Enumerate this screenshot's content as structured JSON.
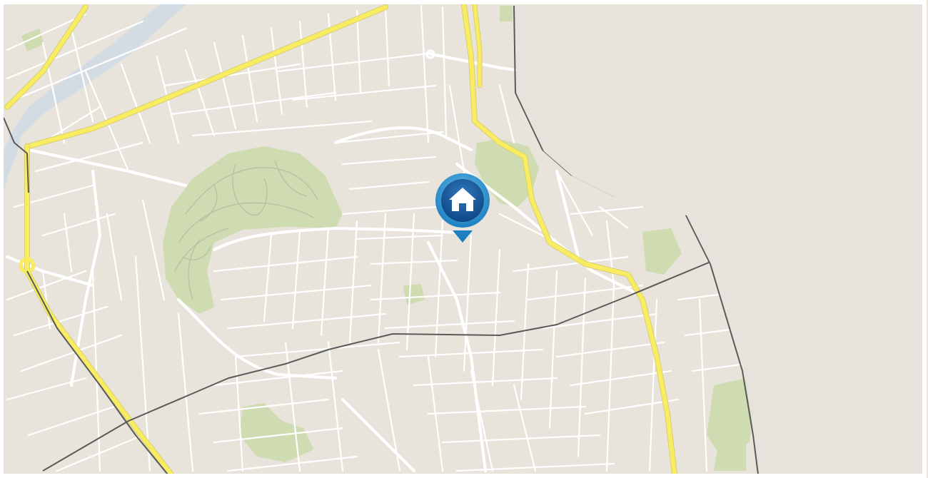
{
  "map": {
    "colors": {
      "land": "#e8e4dc",
      "land_east": "#e6e2dc",
      "park": "#cfdcb2",
      "park_path": "#b9c29f",
      "water": "#d3dbe3",
      "street": "#ffffff",
      "street_edge": "#d8d4cb",
      "highway": "#f7ec62",
      "highway_edge": "#d9cf70",
      "boundary": "#5a5a5a",
      "frame": "#ffffff"
    },
    "marker": {
      "icon": "home-icon",
      "ring_color": "#3ea3d8",
      "fill_color": "#15569a",
      "glyph_color": "#ffffff"
    }
  }
}
